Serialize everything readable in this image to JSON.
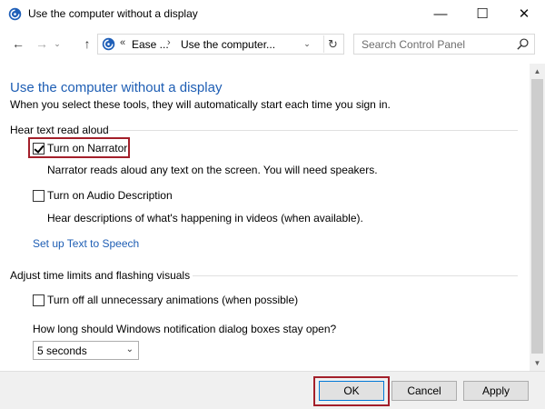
{
  "window": {
    "title": "Use the computer without a display",
    "app_icon": "ease-of-access-icon",
    "controls": {
      "minimize": "—",
      "maximize": "☐",
      "close": "✕"
    }
  },
  "nav": {
    "back_glyph": "←",
    "forward_glyph": "→",
    "recent_glyph": "⌄",
    "up_glyph": "↑",
    "address": {
      "icon": "ease-of-access-icon",
      "overflow": "«",
      "crumb1": "Ease ...",
      "separator": "›",
      "crumb2": "Use the computer...",
      "dropdown_glyph": "⌄",
      "refresh_glyph": "↻"
    },
    "search": {
      "placeholder": "Search Control Panel",
      "value": "",
      "icon": "search-icon"
    }
  },
  "page": {
    "title": "Use the computer without a display",
    "description": "When you select these tools, they will automatically start each time you sign in."
  },
  "sections": {
    "text_aloud": {
      "header": "Hear text read aloud",
      "narrator": {
        "label": "Turn on Narrator",
        "checked": true,
        "description": "Narrator reads aloud any text on the screen. You will need speakers."
      },
      "audio_description": {
        "label": "Turn on Audio Description",
        "checked": false,
        "description": "Hear descriptions of what's happening in videos (when available)."
      },
      "tts_link": "Set up Text to Speech"
    },
    "time_limits": {
      "header": "Adjust time limits and flashing visuals",
      "animations": {
        "label": "Turn off all unnecessary animations (when possible)",
        "checked": false
      },
      "notification_question": "How long should Windows notification dialog boxes stay open?",
      "notification_duration": {
        "selected": "5 seconds",
        "chevron": "⌄"
      }
    }
  },
  "scrollbar": {
    "up_glyph": "▲",
    "down_glyph": "▼"
  },
  "footer": {
    "ok": "OK",
    "cancel": "Cancel",
    "apply": "Apply"
  },
  "colors": {
    "accent": "#1e5eb4",
    "highlight": "#a31f2a",
    "footer_bg": "#f0f0f0"
  }
}
